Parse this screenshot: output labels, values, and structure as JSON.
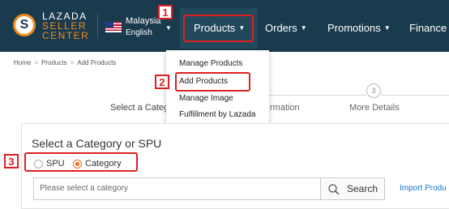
{
  "header": {
    "logo_letter": "S",
    "logo_lines": [
      "LAZADA",
      "SELLER",
      "CENTER"
    ],
    "country": "Malaysia",
    "language": "English",
    "nav": [
      "Products",
      "Orders",
      "Promotions",
      "Finance"
    ]
  },
  "products_menu": {
    "items": [
      "Manage Products",
      "Add Products",
      "Manage Image",
      "Fulfillment by Lazada"
    ]
  },
  "callouts": [
    "1",
    "2",
    "3"
  ],
  "breadcrumb": [
    "Home",
    "Products",
    "Add Products"
  ],
  "steps": {
    "step1_label": "Select a Catego",
    "step2_label": "rmation",
    "step3_number": "3",
    "step3_label": "More Details"
  },
  "form": {
    "title": "Select a Category or SPU",
    "radio_options": [
      "SPU",
      "Category"
    ],
    "selected_option": "Category",
    "category_placeholder": "Please select a category",
    "search_label": "Search",
    "import_link": "Import Produ"
  },
  "colors": {
    "nav_bg": "#1a3b4d",
    "brand_orange": "#f28a1e",
    "callout_red": "#e02020",
    "link_blue": "#1a73c8"
  }
}
